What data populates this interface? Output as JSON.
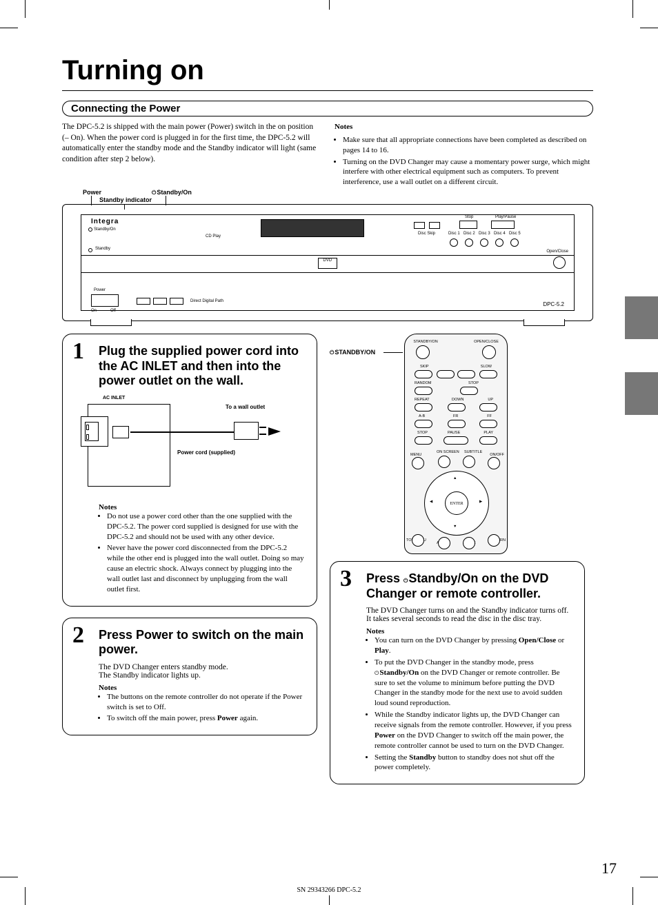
{
  "title": "Turning on",
  "section_heading": "Connecting the Power",
  "intro_para": "The DPC-5.2 is shipped with the main power (Power) switch in the on position (– On). When the power cord is plugged in for the first time, the DPC-5.2 will automatically enter the standby mode and the Standby indicator will light (same condition after step 2 below).",
  "notes_label": "Notes",
  "top_notes": [
    "Make sure that all appropriate connections have been completed as described on pages 14 to 16.",
    "Turning on the DVD Changer may cause a momentary power surge, which might interfere with other electrical equipment such as computers. To prevent interference, use a wall outlet on a different circuit."
  ],
  "device_labels": {
    "power": "Power",
    "standby_on": "Standby/On",
    "standby_indicator": "Standby indicator"
  },
  "device_panel": {
    "brand": "Integra",
    "standby_on": "Standby/On",
    "cd_play": "CD Play",
    "standby": "Standby",
    "stop": "Stop",
    "play_pause": "Play/Pause",
    "disc_skip": "Disc Skip",
    "disc1": "Disc 1",
    "disc2": "Disc 2",
    "disc3": "Disc 3",
    "disc4": "Disc 4",
    "disc5": "Disc 5",
    "open_close": "Open/Close",
    "dvd": "DVD",
    "power_sw": "Power",
    "on": "On",
    "off": "Off",
    "direct_digital": "Direct Digital Path",
    "model": "DPC-5.2"
  },
  "step1": {
    "num": "1",
    "head": "Plug the supplied power cord into the AC INLET and then into the power outlet on the wall.",
    "ac_inlet": "AC INLET",
    "to_wall": "To a wall outlet",
    "power_cord": "Power cord (supplied)",
    "notes": [
      "Do not use a power cord other than the one supplied with the DPC-5.2. The power cord supplied is designed for use with the DPC-5.2 and should not be used with any other device.",
      "Never have the power cord disconnected from the DPC-5.2 while the other end is plugged into the wall outlet. Doing so may cause an electric shock. Always connect by plugging into the wall outlet last and disconnect by unplugging from the wall outlet first."
    ]
  },
  "step2": {
    "num": "2",
    "head": "Press Power to switch on the main power.",
    "body1": "The DVD Changer enters standby mode.",
    "body2": "The Standby indicator lights up.",
    "notes": [
      "The buttons on the remote controller do not operate if the Power switch is set to Off.",
      "To switch off the main power, press Power again."
    ],
    "power_bold": "Power"
  },
  "remote": {
    "side_label": "STANDBY/ON",
    "standby_on": "STANDBY/ON",
    "open_close": "OPEN/CLOSE",
    "skip": "SKIP",
    "slow": "SLOW",
    "random": "RANDOM",
    "stop": "STOP",
    "repeat": "REPEAT",
    "down": "DOWN",
    "up": "UP",
    "ab": "A-B",
    "fr": "FR",
    "ff": "FF",
    "stop2": "STOP",
    "pause": "PAUSE",
    "play": "PLAY",
    "menu": "MENU",
    "on_screen": "ON SCREEN",
    "subtitle": "SUBTITLE",
    "on_off": "ON/OFF",
    "enter": "ENTER",
    "top_menu": "TOP MENU",
    "audio": "AUDIO",
    "angle": "ANGLE",
    "return": "RETURN"
  },
  "step3": {
    "num": "3",
    "head_pre": "Press ",
    "head_mid": "Standby/On on the DVD Changer or remote controller.",
    "body": "The DVD Changer turns on and the Standby indicator turns off. It takes several seconds to read the disc in the disc tray.",
    "notes": [
      "You can turn on the DVD Changer by pressing Open/Close or Play.",
      "To put the DVD Changer in the standby mode, press Standby/On on the DVD Changer or remote controller. Be sure to set the volume to minimum before putting the DVD Changer in the standby mode for the next use to avoid sudden loud sound reproduction.",
      "While the Standby indicator lights up, the DVD Changer can receive signals from the remote controller. However, if you press Power on the DVD Changer to switch off the main power, the remote controller cannot be used to turn on the DVD Changer.",
      "Setting the Standby button to standby does not shut off the power completely."
    ],
    "bold": {
      "open_close": "Open/Close",
      "play": "Play",
      "standby_on": "Standby/On",
      "power": "Power",
      "standby": "Standby"
    }
  },
  "page_number": "17",
  "footer": "SN 29343266 DPC-5.2"
}
